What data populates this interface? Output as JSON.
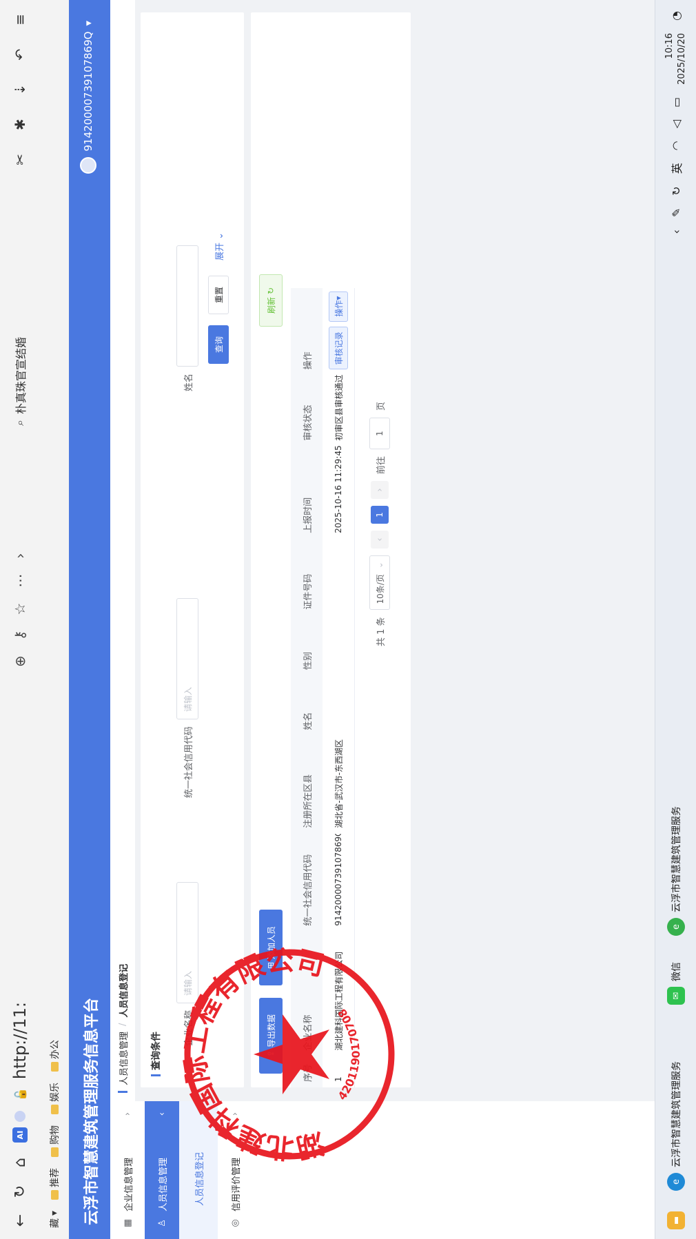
{
  "browser": {
    "url": "http://11:",
    "search_text": "朴真珠官宣结婚",
    "ai_badge": "AI",
    "bookmarks": [
      "推荐",
      "购物",
      "娱乐",
      "办公"
    ],
    "bookmarks_prefix": "藏"
  },
  "app": {
    "title": "云浮市智慧建筑管理服务信息平台",
    "user_id": "91420000739107869Q"
  },
  "sidebar": {
    "items": [
      {
        "label": "企业信息管理"
      },
      {
        "label": "人员信息管理"
      },
      {
        "label": "人员信息登记"
      },
      {
        "label": "信用评价管理"
      }
    ]
  },
  "breadcrumb": {
    "parent": "人员信息管理",
    "current": "人员信息登记"
  },
  "search": {
    "title": "查询条件",
    "company_label": "企业名称",
    "company_placeholder": "请输入",
    "credit_label": "统一社会信用代码",
    "credit_placeholder": "请输入",
    "name_label": "姓名",
    "query_label": "查询",
    "reset_label": "重置",
    "expand_label": "展开"
  },
  "toolbar": {
    "export_label": "导出数据",
    "add_label": "添加人员",
    "refresh_label": "刷新"
  },
  "table": {
    "headers": [
      "序号",
      "企业名称",
      "统一社会信用代码",
      "注册所在区县",
      "姓名",
      "性别",
      "证件号码",
      "上报时间",
      "审核状态",
      "操作"
    ],
    "rows": [
      {
        "index": "1",
        "company": "湖北建科国际工程有限公司",
        "credit_code": "91420000739107869Q",
        "district": "湖北省-武汉市-东西湖区",
        "name": "",
        "gender": "",
        "id_no": "",
        "report_time": "2025-10-16 11:29:45",
        "status": "初审区县审核通过",
        "op_record": "审核记录",
        "op_more": "操作"
      }
    ]
  },
  "pagination": {
    "total": "共 1 条",
    "page_size": "10条/页",
    "current": "1",
    "goto_label": "前往",
    "goto_value": "1",
    "page_unit": "页"
  },
  "stamp": {
    "text": "湖北建科国际工程有限公司",
    "number": "4201190170708",
    "color": "#e8141c"
  },
  "taskbar": {
    "edge_label": "云浮市智慧建筑管理服务",
    "wechat_label": "微信",
    "app_label": "云浮市智慧建筑管理服务",
    "ime": "英",
    "time": "10:16",
    "date": "2025/10/20"
  },
  "colors": {
    "accent": "#4a78e0",
    "success": "#67c23a"
  }
}
